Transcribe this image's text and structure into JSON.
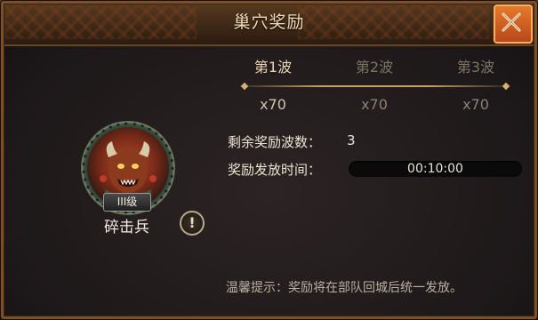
{
  "dialog": {
    "title": "巢穴奖励",
    "close_icon": "close-x-icon"
  },
  "waves": [
    {
      "label": "第1波",
      "reward": "x70",
      "active": true
    },
    {
      "label": "第2波",
      "reward": "x70",
      "active": false
    },
    {
      "label": "第3波",
      "reward": "x70",
      "active": false
    }
  ],
  "info": {
    "remaining_label": "剩余奖励波数：",
    "remaining_value": "3",
    "time_label": "奖励发放时间：",
    "time_value": "00:10:00"
  },
  "unit": {
    "level": "III级",
    "name": "碎击兵",
    "info_glyph": "!"
  },
  "tip": "温馨提示：奖励将在部队回城后统一发放。",
  "colors": {
    "accent": "#e0702a",
    "frame": "#7a5126",
    "text_primary": "#ece3d2",
    "text_muted": "#7d7566"
  }
}
